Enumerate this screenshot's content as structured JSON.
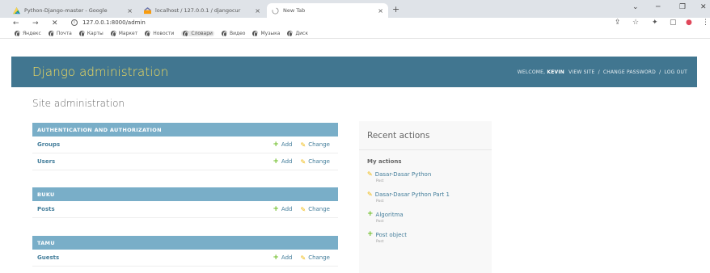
{
  "browser": {
    "tabs": [
      {
        "title": "Python-Django-master - Google",
        "close": "×"
      },
      {
        "title": "localhost / 127.0.0.1 / djangocur",
        "close": "×"
      },
      {
        "title": "New Tab",
        "close": "×"
      }
    ],
    "new_tab": "+",
    "window_controls": {
      "minimize": "⌄",
      "restore": "─",
      "maximize": "❐",
      "close": "✕"
    },
    "nav": {
      "back": "←",
      "forward": "→",
      "stop": "✕"
    },
    "address": "127.0.0.1:8000/admin",
    "info_glyph": "i",
    "toolbar_icons": {
      "share": "⇪",
      "star": "☆",
      "extensions": "✦",
      "sidebar": "▢",
      "profile": "●",
      "menu": "⋮"
    },
    "bookmarks": [
      "Яндекс",
      "Почта",
      "Карты",
      "Маркет",
      "Новости",
      "Словари",
      "Видео",
      "Музыка",
      "Диск"
    ]
  },
  "header": {
    "branding": "Django administration",
    "welcome": "WELCOME,",
    "user": "KEVIN",
    "view_site": "VIEW SITE",
    "change_password": "CHANGE PASSWORD",
    "log_out": "LOG OUT",
    "sep": "/"
  },
  "site_title": "Site administration",
  "modules": {
    "auth": {
      "caption": "Authentication and Authorization",
      "rows": [
        {
          "name": "Groups"
        },
        {
          "name": "Users"
        }
      ]
    },
    "buku": {
      "caption": "Buku",
      "rows": [
        {
          "name": "Posts"
        }
      ]
    },
    "tamu": {
      "caption": "Tamu",
      "rows": [
        {
          "name": "Guests"
        }
      ]
    }
  },
  "actions": {
    "add": "Add",
    "change": "Change",
    "plus_glyph": "+",
    "pencil_glyph": "✎"
  },
  "recent": {
    "title": "Recent actions",
    "subtitle": "My actions",
    "items": [
      {
        "icon": "✎",
        "text": "Dasar-Dasar Python",
        "type": "Post"
      },
      {
        "icon": "✎",
        "text": "Dasar-Dasar Python Part 1",
        "type": "Post"
      },
      {
        "icon": "+",
        "text": "Algoritma",
        "type": "Post"
      },
      {
        "icon": "+",
        "text": "Post object",
        "type": "Post"
      }
    ]
  },
  "colors": {
    "header_bg": "#417690",
    "branding": "#f5dd5d",
    "module_caption": "#79aec8",
    "link": "#447e9b",
    "add_icon": "#70bf2b",
    "change_icon": "#efb80b"
  }
}
